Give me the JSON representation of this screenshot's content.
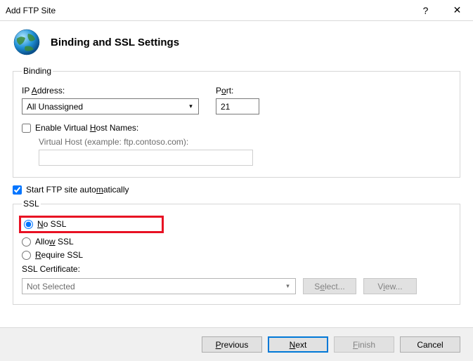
{
  "window": {
    "title": "Add FTP Site",
    "help": "?",
    "close": "✕"
  },
  "header": {
    "title": "Binding and SSL Settings"
  },
  "binding": {
    "legend": "Binding",
    "ip_label_pre": "IP ",
    "ip_label_ul": "A",
    "ip_label_post": "ddress:",
    "ip_value": "All Unassigned",
    "port_label_pre": "P",
    "port_label_ul": "o",
    "port_label_post": "rt:",
    "port_value": "21",
    "enable_vhost_pre": "Enable Virtual ",
    "enable_vhost_ul": "H",
    "enable_vhost_post": "ost Names:",
    "enable_vhost_checked": false,
    "vhost_label": "Virtual Host (example: ftp.contoso.com):",
    "vhost_value": ""
  },
  "start_auto": {
    "label_pre": "Start FTP site auto",
    "label_ul": "m",
    "label_post": "atically",
    "checked": true
  },
  "ssl": {
    "legend": "SSL",
    "no_ssl_ul": "N",
    "no_ssl_post": "o SSL",
    "allow_pre": "Allo",
    "allow_ul": "w",
    "allow_post": " SSL",
    "require_ul": "R",
    "require_post": "equire SSL",
    "selected": "no",
    "cert_label_pre": "SSL ",
    "cert_label_ul": "C",
    "cert_label_post": "ertificate:",
    "cert_value": "Not Selected",
    "select_btn_pre": "S",
    "select_btn_ul": "e",
    "select_btn_post": "lect...",
    "view_btn_pre": "V",
    "view_btn_ul": "i",
    "view_btn_post": "ew..."
  },
  "footer": {
    "previous_ul": "P",
    "previous_post": "revious",
    "next_ul": "N",
    "next_post": "ext",
    "finish_ul": "F",
    "finish_post": "inish",
    "cancel": "Cancel"
  }
}
